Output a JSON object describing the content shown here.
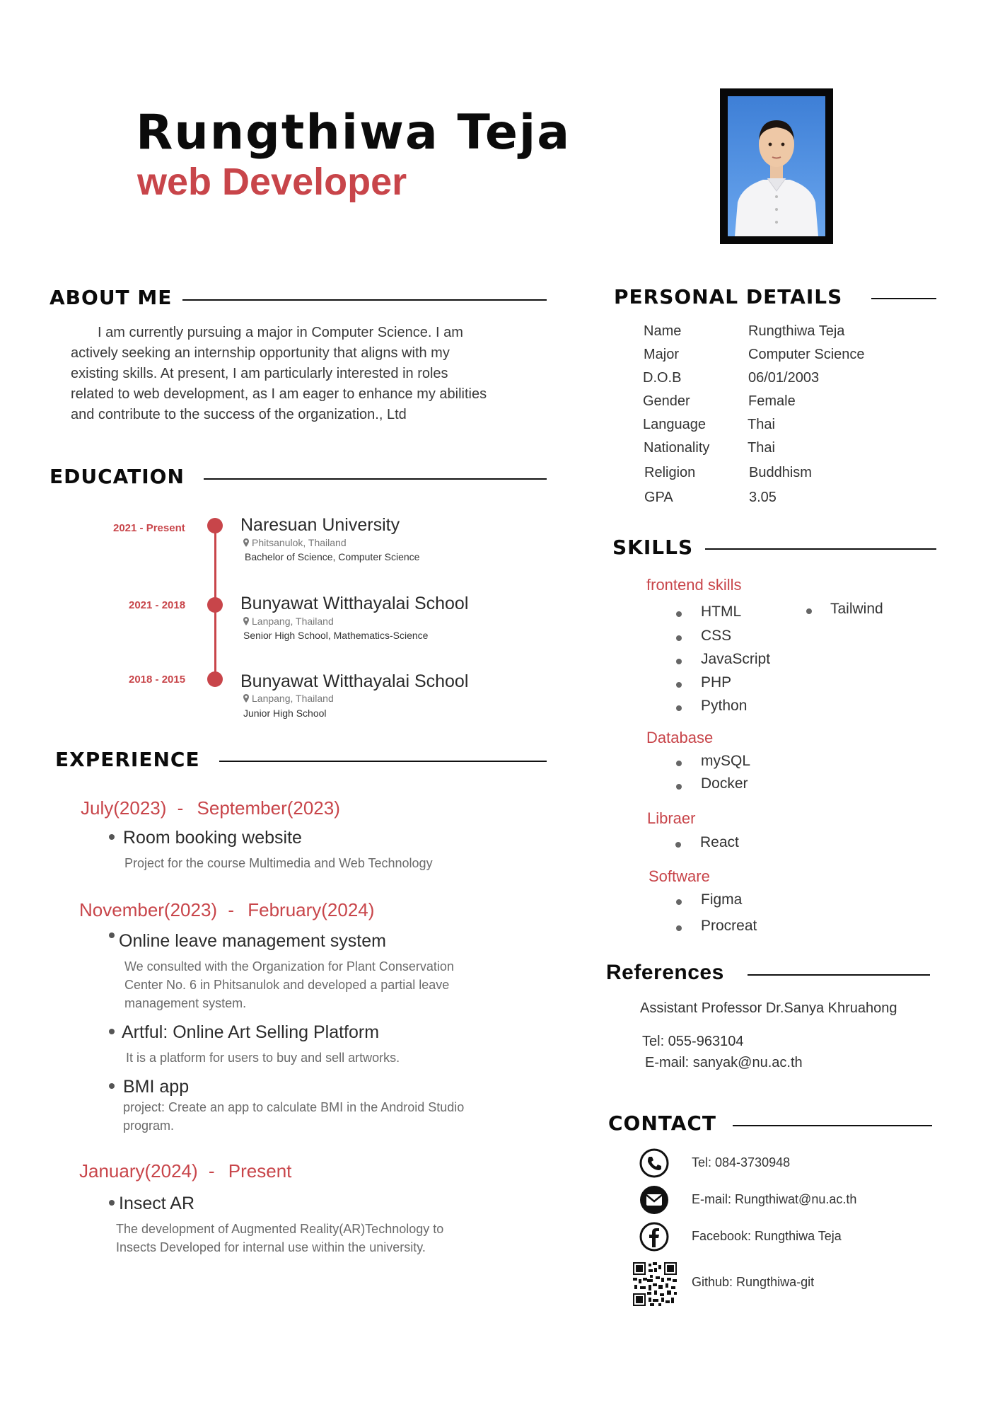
{
  "header": {
    "name": "Rungthiwa Teja",
    "role": "web Developer",
    "accent_color": "#c8454a"
  },
  "about": {
    "heading": "ABOUT ME",
    "lines": [
      "I am currently pursuing a major in Computer Science. I am",
      "actively seeking an internship opportunity that aligns with my",
      "existing skills. At present, I am particularly interested in roles",
      "related to web development, as I am eager to enhance my abilities",
      "and contribute to the success of the organization., Ltd"
    ]
  },
  "education": {
    "heading": "EDUCATION",
    "items": [
      {
        "date": "2021 - Present",
        "school": "Naresuan University",
        "location": "Phitsanulok, Thailand",
        "degree": "Bachelor of Science, Computer Science"
      },
      {
        "date": "2021 - 2018",
        "school": "Bunyawat Witthayalai School",
        "location": "Lanpang, Thailand",
        "degree": "Senior High School, Mathematics-Science"
      },
      {
        "date": "2018 - 2015",
        "school": "Bunyawat Witthayalai School",
        "location": "Lanpang, Thailand",
        "degree": "Junior High School"
      }
    ]
  },
  "experience": {
    "heading": "EXPERIENCE",
    "periods": [
      {
        "start": "July(2023)",
        "sep": "-",
        "end": "September(2023)"
      },
      {
        "start": "November(2023)",
        "sep": "-",
        "end": "February(2024)"
      },
      {
        "start": "January(2024)",
        "sep": "-",
        "end": "Present"
      }
    ],
    "projects": [
      {
        "title": "Room booking website",
        "desc": [
          "Project for the course Multimedia and Web Technology"
        ]
      },
      {
        "title": "Online leave management system",
        "desc": [
          "We consulted with the Organization for Plant Conservation",
          "Center No. 6 in Phitsanulok and developed a partial leave",
          "management system."
        ]
      },
      {
        "title": "Artful: Online Art Selling Platform",
        "desc": [
          "It is a platform for users to buy and sell artworks."
        ]
      },
      {
        "title": "BMI app",
        "desc": [
          "project: Create an app to calculate BMI in the Android Studio",
          "program."
        ]
      },
      {
        "title": "Insect AR",
        "desc": [
          "The development of Augmented Reality(AR)Technology to",
          "Insects Developed for internal use within the university."
        ]
      }
    ]
  },
  "personal": {
    "heading": "PERSONAL DETAILS",
    "rows": [
      {
        "label": "Name",
        "value": "Rungthiwa Teja"
      },
      {
        "label": "Major",
        "value": "Computer Science"
      },
      {
        "label": "D.O.B",
        "value": "06/01/2003"
      },
      {
        "label": "Gender",
        "value": "Female"
      },
      {
        "label": "Language",
        "value": "Thai"
      },
      {
        "label": "Nationality",
        "value": "Thai"
      },
      {
        "label": "Religion",
        "value": "Buddhism"
      },
      {
        "label": "GPA",
        "value": "3.05"
      }
    ]
  },
  "skills": {
    "heading": "SKILLS",
    "groups": [
      {
        "title": "frontend skills",
        "items": [
          "HTML",
          "CSS",
          "JavaScript",
          "PHP",
          "Python",
          "Tailwind"
        ]
      },
      {
        "title": "Database",
        "items": [
          "mySQL",
          "Docker"
        ]
      },
      {
        "title": "Libraer",
        "items": [
          "React"
        ]
      },
      {
        "title": "Software",
        "items": [
          "Figma",
          "Procreat"
        ]
      }
    ]
  },
  "references": {
    "heading": "References",
    "name": "Assistant Professor Dr.Sanya Khruahong",
    "tel": "Tel: 055-963104",
    "email": "E-mail: sanyak@nu.ac.th"
  },
  "contact": {
    "heading": "CONTACT",
    "items": [
      {
        "icon": "phone-icon",
        "text": "Tel: 084-3730948"
      },
      {
        "icon": "email-icon",
        "text": "E-mail: Rungthiwat@nu.ac.th"
      },
      {
        "icon": "facebook-icon",
        "text": "Facebook: Rungthiwa Teja"
      },
      {
        "icon": "qr-code-icon",
        "text": "Github: Rungthiwa-git"
      }
    ]
  }
}
